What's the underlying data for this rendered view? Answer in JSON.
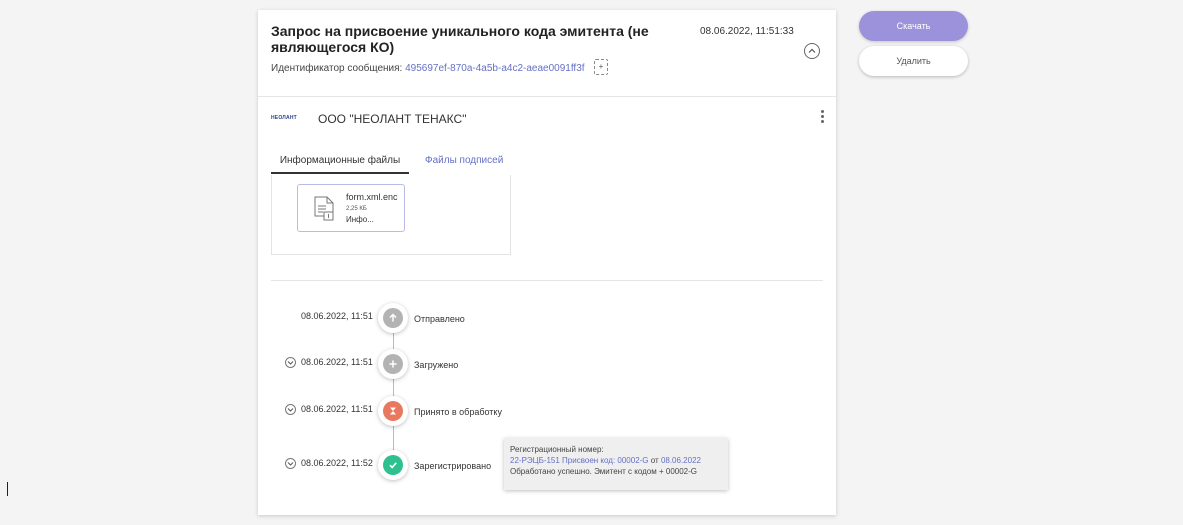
{
  "message": {
    "title": "Запрос на присвоение уникального кода эмитента (не являющегося КО)",
    "date": "08.06.2022, 11:51:33",
    "id_label": "Идентификатор сообщения:",
    "id_value": "495697ef-870a-4a5b-a4c2-aeae0091ff3f"
  },
  "organization": {
    "logo_text": "НЕОЛАНТ",
    "name": "ООО \"НЕОЛАНТ ТЕНАКС\""
  },
  "tabs": [
    {
      "label": "Информационные файлы",
      "active": true
    },
    {
      "label": "Файлы подписей",
      "active": false
    }
  ],
  "file": {
    "name": "form.xml.enc",
    "size": "2,25 КБ",
    "type": "Инфо..."
  },
  "timeline": [
    {
      "time": "08.06.2022, 11:51",
      "label": "Отправлено",
      "icon": "arrow-up-icon",
      "color": "#b3b3b3",
      "expandable": false
    },
    {
      "time": "08.06.2022, 11:51",
      "label": "Загружено",
      "icon": "plus-icon",
      "color": "#b3b3b3",
      "expandable": true
    },
    {
      "time": "08.06.2022, 11:51",
      "label": "Принято в обработку",
      "icon": "hourglass-icon",
      "color": "#e8795e",
      "expandable": true
    },
    {
      "time": "08.06.2022, 11:52",
      "label": "Зарегистрировано",
      "icon": "check-icon",
      "color": "#2fc08f",
      "expandable": true
    }
  ],
  "tooltip": {
    "line1": "Регистрационный номер:",
    "reg_link": "22-РЭЦБ-151 Присвоен код: 00002-G",
    "from": "от",
    "date_link": "08.06.2022",
    "line3": "Обработано успешно. Эмитент с кодом + 00002-G"
  },
  "actions": {
    "download": "Скачать",
    "delete": "Удалить"
  },
  "colors": {
    "accent": "#9b92db",
    "link": "#6670c4",
    "success": "#2fc08f",
    "processing": "#e8795e",
    "neutral": "#b3b3b3"
  }
}
